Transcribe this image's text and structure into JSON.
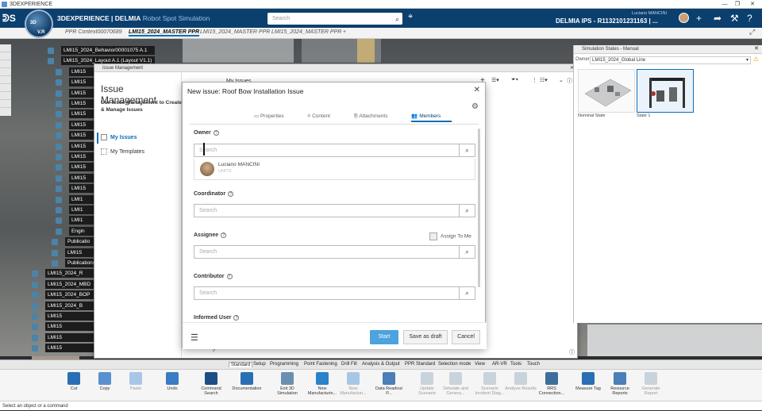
{
  "window": {
    "title": "3DEXPERIENCE"
  },
  "topbar": {
    "brand": "3DEXPERIENCE | DELMIA",
    "app": "Robot Spot Simulation",
    "search_placeholder": "Search",
    "user_name": "Luciano MANCINI",
    "context": "DELMIA IPS - R1132101231163 | ...",
    "compass_labels": [
      "3D",
      "V.R"
    ]
  },
  "tabs": [
    "PPR Context00070689",
    "LMI15_2024_MASTER PPR",
    "LMI15_2024_MASTER PPR",
    "LMI15_2024_MASTER PPR"
  ],
  "tree": [
    "LMI15_2024_Behavior00001075 A.1",
    "LMI15_2024_Layout A.1 (Layout V1.1)",
    "LMI15",
    "LMI15",
    "LMI15",
    "LMI15",
    "LMI15",
    "LMI15",
    "LMI15",
    "LMI15",
    "LMI15",
    "LMI15",
    "LMI15",
    "LMI15",
    "LMI1",
    "LMI1",
    "LMI1",
    "Engin",
    "Publicatio",
    "LMI15",
    "Publications",
    "LMI15_2024_R",
    "LMI15_2024_MBD",
    "LMI15_2024_BOP",
    "LMI15_2024_B",
    "LMI15",
    "LMI15",
    "LMI15",
    "LMI15",
    "LMI15"
  ],
  "issue_mgmt": {
    "panel_title": "Issue Management",
    "title": "Issue Management",
    "subtitle": "Use Issue Management to Create & Manage Issues",
    "nav": [
      {
        "label": "My Issues"
      },
      {
        "label": "My Templates"
      }
    ],
    "list_title": "My Issues"
  },
  "dialog": {
    "title": "New issue: Roof Bow Installation Issue",
    "tabs": [
      "Properties",
      "Content",
      "Attachments",
      "Members"
    ],
    "active_tab": "Members",
    "owner": {
      "label": "Owner",
      "placeholder": "Search",
      "person_name": "Luciano MANCINI",
      "person_sub": "UNITS"
    },
    "coordinator": {
      "label": "Coordinator",
      "placeholder": "Search"
    },
    "assignee": {
      "label": "Assignee",
      "placeholder": "Search",
      "assign_to_me": "Assign To Me"
    },
    "contributor": {
      "label": "Contributor",
      "placeholder": "Search"
    },
    "informed": {
      "label": "Informed User"
    },
    "buttons": {
      "start": "Start",
      "draft": "Save as draft",
      "cancel": "Cancel"
    }
  },
  "sim_states": {
    "title": "Simulation States - Manual",
    "owner_label": "Owner",
    "owner_value": "LMI15_2024_Global Line",
    "states": [
      {
        "label": "Nominal State"
      },
      {
        "label": "State 1"
      }
    ]
  },
  "ribbon": {
    "tabs": [
      "Standard",
      "Setup",
      "Programming",
      "Point Fastening",
      "Drill Fill",
      "Analysis & Output",
      "PPR Standard",
      "Selection mode",
      "View",
      "AR-VR",
      "Tools",
      "Touch"
    ],
    "active_tab": "Standard",
    "commands": [
      {
        "label": "Cut",
        "enabled": true
      },
      {
        "label": "Copy",
        "enabled": true
      },
      {
        "label": "Paste",
        "enabled": false
      },
      {
        "label": "Undo",
        "enabled": true
      },
      {
        "label": "Command Search",
        "enabled": true
      },
      {
        "label": "Documentation",
        "enabled": true
      },
      {
        "label": "Exit 3D Simulation",
        "enabled": true
      },
      {
        "label": "New Manufacturin...",
        "enabled": true
      },
      {
        "label": "New Manufacturi...",
        "enabled": false
      },
      {
        "label": "Data Readout P...",
        "enabled": true
      },
      {
        "label": "Update Scenario",
        "enabled": false
      },
      {
        "label": "Simulate and Genera...",
        "enabled": false
      },
      {
        "label": "Scenario Incident Diag...",
        "enabled": false
      },
      {
        "label": "Analyze Results",
        "enabled": false
      },
      {
        "label": "RRS Connection...",
        "enabled": true
      },
      {
        "label": "Measure Tag",
        "enabled": true
      },
      {
        "label": "Resource Reports",
        "enabled": true
      },
      {
        "label": "Generate Report",
        "enabled": false
      }
    ]
  },
  "status": {
    "text": "Select an object or a command"
  }
}
